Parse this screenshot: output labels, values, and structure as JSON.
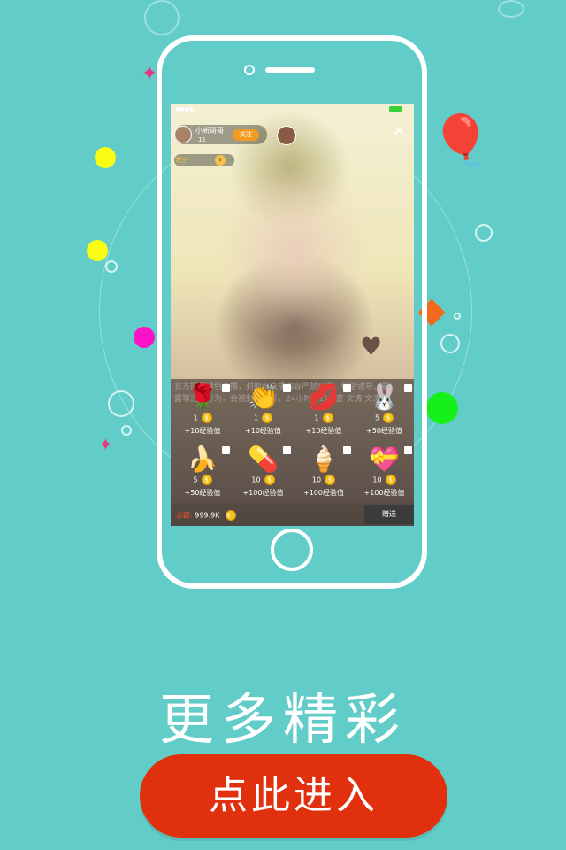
{
  "screen": {
    "host": {
      "name": "小新哥哥",
      "count": "11",
      "follow_label": "关注"
    },
    "stat_label": "积分",
    "chat_text": "官方提倡绿色直播，封面和直播内容严禁吸烟、低俗诱导、暴露等违规行为，会被封停账号，24小时在线巡查 文涛 文涛",
    "gifts": [
      {
        "icon": "rose-icon",
        "glyph": "🌹",
        "price": "1",
        "exp": "+10经验值"
      },
      {
        "icon": "clap-icon",
        "glyph": "👏",
        "price": "1",
        "exp": "+10经验值"
      },
      {
        "icon": "lips-icon",
        "glyph": "💋",
        "price": "1",
        "exp": "+10经验值"
      },
      {
        "icon": "bunny-icon",
        "glyph": "🐰",
        "price": "5",
        "exp": "+50经验值"
      },
      {
        "icon": "banana-icon",
        "glyph": "🍌",
        "price": "5",
        "exp": "+50经验值"
      },
      {
        "icon": "pill-icon",
        "glyph": "💊",
        "price": "10",
        "exp": "+100经验值"
      },
      {
        "icon": "icecream-icon",
        "glyph": "🍦",
        "price": "10",
        "exp": "+100经验值"
      },
      {
        "icon": "winged-heart-icon",
        "glyph": "💝",
        "price": "10",
        "exp": "+100经验值"
      }
    ],
    "balance_label": "余额:",
    "balance_value": "999.9K",
    "send_label": "赠送"
  },
  "headline": "更多精彩",
  "enter_button": "点此进入",
  "colors": {
    "background": "#62cdc8",
    "enter_button": "#e0300e",
    "follow": "#f39a22",
    "coin": "#f5c21a"
  }
}
